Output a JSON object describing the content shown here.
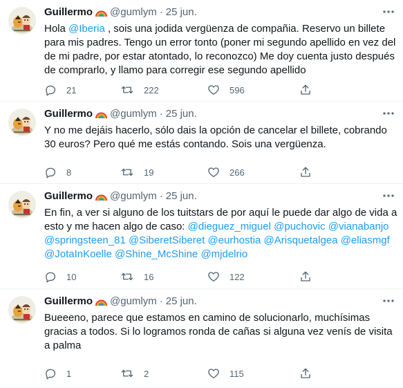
{
  "tweets": [
    {
      "name": "Guillermo",
      "handle": "@gumlym",
      "date": "25 jun.",
      "parts": [
        {
          "text": "Hola ",
          "mention": false
        },
        {
          "text": "@Iberia",
          "mention": true
        },
        {
          "text": " , sois una jodida vergüenza de compañia. Reservo un billete para mis padres. Tengo un error tonto (poner mi segundo apellido en vez del de mi padre, por estar atontado, lo reconozco) Me doy cuenta justo después de comprarlo, y llamo para corregir ese segundo apellido",
          "mention": false
        }
      ],
      "replies": "21",
      "retweets": "222",
      "likes": "596"
    },
    {
      "name": "Guillermo",
      "handle": "@gumlym",
      "date": "25 jun.",
      "parts": [
        {
          "text": "Y no me dejáis hacerlo, sólo dais la opción de cancelar el billete, cobrando 30 euros? Pero qué me estás contando. Sois una vergüenza.",
          "mention": false
        }
      ],
      "replies": "8",
      "retweets": "19",
      "likes": "266"
    },
    {
      "name": "Guillermo",
      "handle": "@gumlym",
      "date": "25 jun.",
      "parts": [
        {
          "text": "En fin, a ver si alguno de los tuitstars de por aquí le puede dar algo de vida a esto y me hacen algo de caso: ",
          "mention": false
        },
        {
          "text": "@dieguez_miguel",
          "mention": true
        },
        {
          "text": " ",
          "mention": false
        },
        {
          "text": "@puchovic",
          "mention": true
        },
        {
          "text": " ",
          "mention": false
        },
        {
          "text": "@vianabanjo",
          "mention": true
        },
        {
          "text": " ",
          "mention": false
        },
        {
          "text": "@springsteen_81",
          "mention": true
        },
        {
          "text": " ",
          "mention": false
        },
        {
          "text": "@SiberetSiberet",
          "mention": true
        },
        {
          "text": " ",
          "mention": false
        },
        {
          "text": "@eurhostia",
          "mention": true
        },
        {
          "text": " ",
          "mention": false
        },
        {
          "text": "@Arisquetalgea",
          "mention": true
        },
        {
          "text": " ",
          "mention": false
        },
        {
          "text": "@eliasmgf",
          "mention": true
        },
        {
          "text": " ",
          "mention": false
        },
        {
          "text": "@JotaInKoelle",
          "mention": true
        },
        {
          "text": " ",
          "mention": false
        },
        {
          "text": "@Shine_McShine",
          "mention": true
        },
        {
          "text": " ",
          "mention": false
        },
        {
          "text": "@mjdelrio",
          "mention": true
        }
      ],
      "replies": "10",
      "retweets": "16",
      "likes": "122"
    },
    {
      "name": "Guillermo",
      "handle": "@gumlym",
      "date": "25 jun.",
      "parts": [
        {
          "text": "Bueeeno, parece que estamos en camino de solucionarlo, muchísimas gracias a todos. Si lo logramos ronda de cañas si alguna vez venís de visita a palma",
          "mention": false
        }
      ],
      "replies": "1",
      "retweets": "2",
      "likes": "115"
    }
  ],
  "icons": {
    "avatar": "cartoon-avatar",
    "badge": "rainbow-emoji",
    "more": "more-options-icon",
    "reply": "reply-icon",
    "retweet": "retweet-icon",
    "like": "heart-icon",
    "share": "share-icon"
  },
  "colors": {
    "text": "#0f1419",
    "secondary": "#536471",
    "mention": "#1d9bf0",
    "divider": "#eff3f4"
  }
}
